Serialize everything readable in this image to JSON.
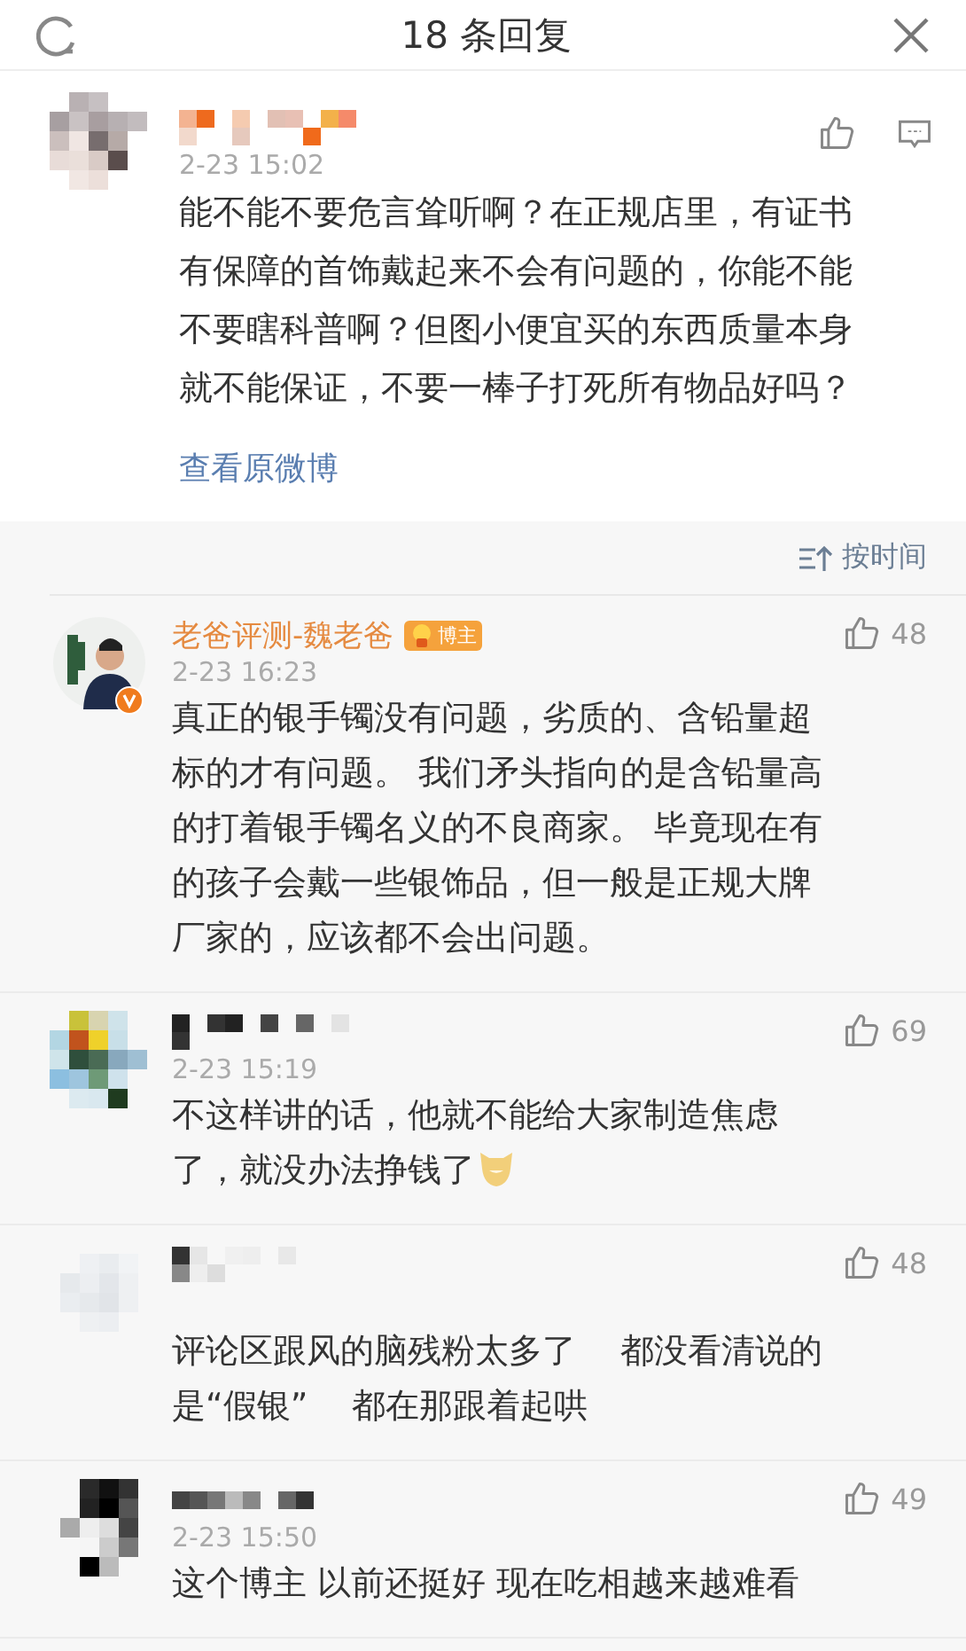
{
  "header": {
    "title": "18 条回复"
  },
  "top_comment": {
    "time": "2-23 15:02",
    "lines": [
      "能不能不要危言耸听啊？在正规店里，有证书",
      "有保障的首饰戴起来不会有问题的，你能不能",
      "不要瞎科普啊？但图小便宜买的东西质量本身",
      "就不能保证，不要一棒子打死所有物品好吗？"
    ],
    "link": "查看原微博"
  },
  "sort": {
    "label": "按时间"
  },
  "comments": [
    {
      "kind": "blogger",
      "name": "老爸评测-魏老爸",
      "badge": "博主",
      "verified": true,
      "time": "2-23 16:23",
      "likes": "48",
      "lines": [
        "真正的银手镯没有问题，劣质的、含铅量超",
        "标的才有问题。 我们矛头指向的是含铅量高",
        "的打着银手镯名义的不良商家。 毕竟现在有",
        "的孩子会戴一些银饰品，但一般是正规大牌",
        "厂家的，应该都不会出问题。"
      ]
    },
    {
      "kind": "anonymized",
      "time": "2-23 15:19",
      "likes": "69",
      "emoji": true,
      "lines": [
        "不这样讲的话，他就不能给大家制造焦虑",
        "了，就没办法挣钱了"
      ]
    },
    {
      "kind": "anonymized",
      "likes": "48",
      "lines": [
        "评论区跟风的脑残粉太多了　 都没看清说的",
        "是“假银”　 都在那跟着起哄"
      ]
    },
    {
      "kind": "anonymized",
      "time": "2-23 15:50",
      "likes": "49",
      "lines": [
        "这个博主 以前还挺好 现在吃相越来越难看"
      ]
    }
  ]
}
